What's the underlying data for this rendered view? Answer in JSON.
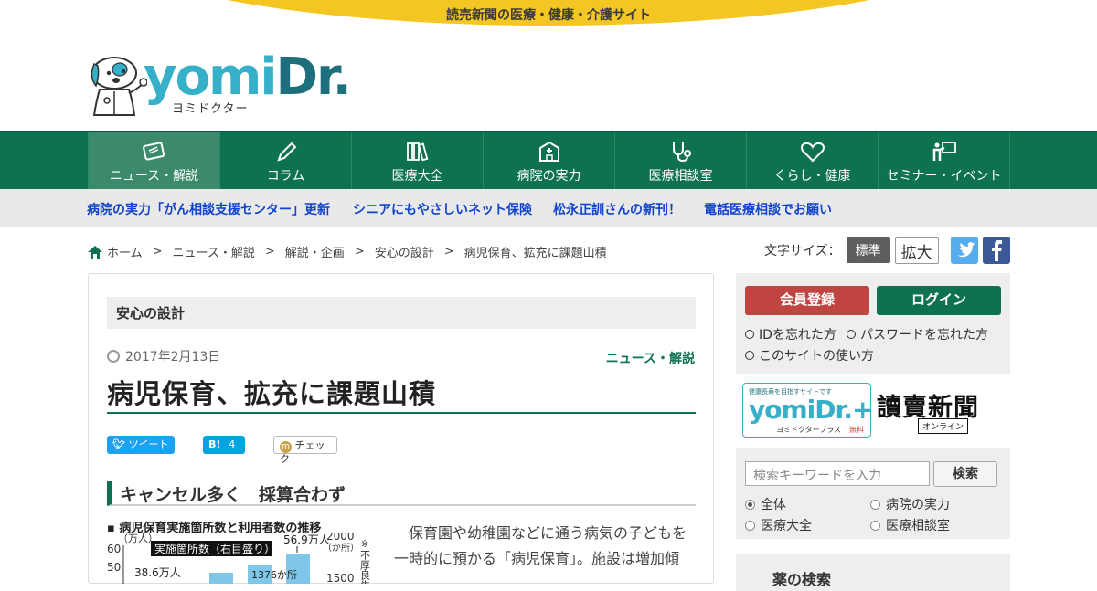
{
  "site": {
    "tagline": "読売新聞の医療・健康・介護サイト",
    "logo_word_a": "yomi",
    "logo_word_b": "Dr.",
    "logo_kana": "ヨミドクター"
  },
  "global_nav": [
    {
      "label": "ニュース・解説",
      "icon": "newspaper-icon",
      "active": true
    },
    {
      "label": "コラム",
      "icon": "pencil-icon",
      "active": false
    },
    {
      "label": "医療大全",
      "icon": "books-icon",
      "active": false
    },
    {
      "label": "病院の実力",
      "icon": "hospital-icon",
      "active": false
    },
    {
      "label": "医療相談室",
      "icon": "stethoscope-icon",
      "active": false
    },
    {
      "label": "くらし・健康",
      "icon": "heart-icon",
      "active": false
    },
    {
      "label": "セミナー・イベント",
      "icon": "presenter-icon",
      "active": false
    }
  ],
  "sub_nav": [
    "病院の実力「がん相談支援センター」更新",
    "シニアにもやさしいネット保険",
    "松永正訓さんの新刊！",
    "電話医療相談でお願い"
  ],
  "breadcrumb": [
    "ホーム",
    "ニュース・解説",
    "解説・企画",
    "安心の設計",
    "病児保育、拡充に課題山積"
  ],
  "font_size": {
    "label": "文字サイズ：",
    "standard": "標準",
    "large": "拡大"
  },
  "article": {
    "category_box": "安心の設計",
    "date": "2017年2月13日",
    "category": "ニュース・解説",
    "title": "病児保育、拡充に課題山積",
    "share": {
      "tweet": "ツイート",
      "hatena_count": "4",
      "check": "チェック"
    },
    "heading": "キャンセル多く　採算合わず",
    "chart": {
      "title": "病児保育実施箇所数と利用者数の推移",
      "left_unit": "（万人）",
      "right_unit": "（か所）",
      "series_label": "実施箇所数（右目盛り）",
      "ann_1": "56.9万人",
      "ann_2": "38.6万人",
      "ann_3": "1376か所",
      "note": "※不厚良生"
    },
    "body_line1": "保育園や幼稚園などに通う病気の子どもを",
    "body_line2": "一時的に預かる「病児保育」。施設は増加傾"
  },
  "chart_data": {
    "type": "bar",
    "title": "病児保育実施箇所数と利用者数の推移",
    "y_left": {
      "label": "（万人）",
      "ticks": [
        50,
        60
      ]
    },
    "y_right": {
      "label": "（か所）",
      "ticks": [
        1500,
        2000
      ]
    },
    "annotations": [
      "実施箇所数（右目盛り）",
      "56.9万人",
      "38.6万人",
      "1376か所"
    ]
  },
  "sidebar": {
    "register": "会員登録",
    "login": "ログイン",
    "forgot_id": "IDを忘れた方",
    "forgot_pw": "パスワードを忘れた方",
    "howto": "このサイトの使い方",
    "plus_small": "健康長寿を目指すサイトです",
    "plus_word": "yomiDr.+",
    "plus_kana": "ヨミドクタープラス",
    "plus_free": "無料",
    "yomiuri": "讀賣新聞",
    "yomiuri_online": "オンライン",
    "search_placeholder": "検索キーワードを入力",
    "search_button": "検索",
    "radios": [
      "全体",
      "病院の実力",
      "医療大全",
      "医療相談室"
    ],
    "box3_title": "薬の検索"
  },
  "colors": {
    "brand_green": "#0e7250",
    "accent_yellow": "#f3c623",
    "register_red": "#c0443f",
    "link_blue": "#1144cc"
  }
}
